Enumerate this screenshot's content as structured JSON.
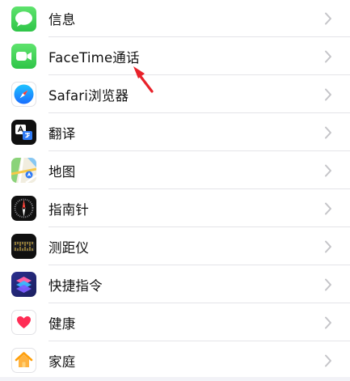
{
  "settings_list": {
    "items": [
      {
        "id": "messages",
        "label": "信息",
        "icon": "messages-icon",
        "color": "#34c759"
      },
      {
        "id": "facetime",
        "label": "FaceTime通话",
        "icon": "facetime-icon",
        "color": "#34c759"
      },
      {
        "id": "safari",
        "label": "Safari浏览器",
        "icon": "safari-icon",
        "color": "#1a8cff"
      },
      {
        "id": "translate",
        "label": "翻译",
        "icon": "translate-icon",
        "color": "#101010"
      },
      {
        "id": "maps",
        "label": "地图",
        "icon": "maps-icon",
        "color": "#5fc65f"
      },
      {
        "id": "compass",
        "label": "指南针",
        "icon": "compass-icon",
        "color": "#101010"
      },
      {
        "id": "measure",
        "label": "测距仪",
        "icon": "measure-icon",
        "color": "#101010"
      },
      {
        "id": "shortcuts",
        "label": "快捷指令",
        "icon": "shortcuts-icon",
        "color": "#3a2fae"
      },
      {
        "id": "health",
        "label": "健康",
        "icon": "health-icon",
        "color": "#ff2d55"
      },
      {
        "id": "home",
        "label": "家庭",
        "icon": "home-icon",
        "color": "#ff9f0a"
      }
    ]
  },
  "annotation": {
    "icon": "red-arrow-icon",
    "color": "#e8222a"
  },
  "colors": {
    "chevron": "#c4c4c8",
    "separator": "#e4e4e8",
    "background": "#f2f2f7"
  }
}
